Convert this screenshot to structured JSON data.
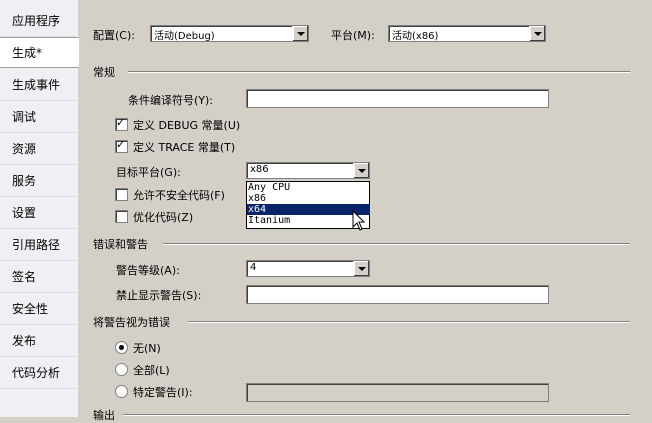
{
  "sidebar": {
    "tabs": [
      {
        "label": "应用程序"
      },
      {
        "label": "生成*"
      },
      {
        "label": "生成事件"
      },
      {
        "label": "调试"
      },
      {
        "label": "资源"
      },
      {
        "label": "服务"
      },
      {
        "label": "设置"
      },
      {
        "label": "引用路径"
      },
      {
        "label": "签名"
      },
      {
        "label": "安全性"
      },
      {
        "label": "发布"
      },
      {
        "label": "代码分析"
      }
    ],
    "active_index": 1
  },
  "top": {
    "config_label": "配置(C):",
    "config_value": "活动(Debug)",
    "platform_label": "平台(M):",
    "platform_value": "活动(x86)"
  },
  "general": {
    "title": "常规",
    "symbols_label": "条件编译符号(Y):",
    "symbols_value": "",
    "debug_label": "定义 DEBUG 常量(U)",
    "debug_checked": true,
    "trace_label": "定义 TRACE 常量(T)",
    "trace_checked": true,
    "target_label": "目标平台(G):",
    "target_value": "x86",
    "target_options": [
      "Any CPU",
      "x86",
      "x64",
      "Itanium"
    ],
    "target_highlighted": "x64",
    "unsafe_label": "允许不安全代码(F)",
    "unsafe_checked": false,
    "optimize_label": "优化代码(Z)",
    "optimize_checked": false
  },
  "errors": {
    "title": "错误和警告",
    "level_label": "警告等级(A):",
    "level_value": "4",
    "suppress_label": "禁止显示警告(S):",
    "suppress_value": ""
  },
  "treat": {
    "title": "将警告视为错误",
    "none_label": "无(N)",
    "all_label": "全部(L)",
    "specific_label": "特定警告(I):",
    "selected": "none"
  },
  "output": {
    "title": "输出"
  },
  "colors": {
    "highlight": "#0a246a",
    "panel": "#d4d0c8"
  }
}
